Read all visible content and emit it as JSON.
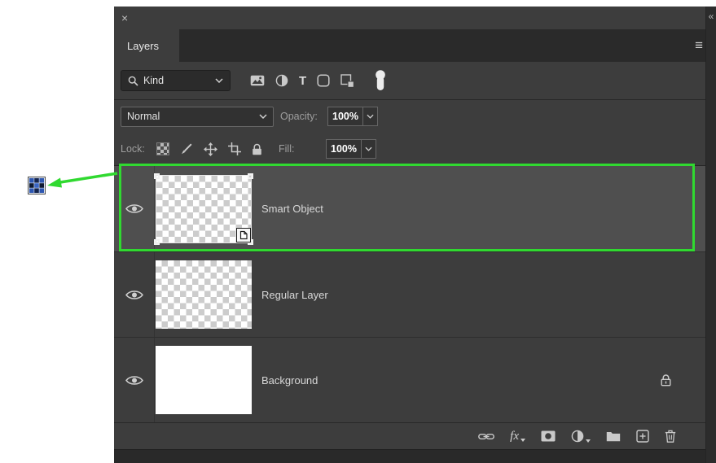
{
  "colors": {
    "highlight_green": "#30d930",
    "panel_bg": "#3d3d3d",
    "selected_row_bg": "#4f4f4f"
  },
  "annotation": {
    "callout_icon": "smart-object-mini-icon",
    "arrow": "green-arrow-pointing-left-from-selected-layer"
  },
  "panel": {
    "close_icon": "×",
    "collapse_icon": "«",
    "menu_icon": "≡",
    "title_tab": "Layers",
    "filter_row": {
      "kind_label": "Kind",
      "type_glyph": "T",
      "icons": [
        "search-icon",
        "pixel-layer-filter-icon",
        "adjustment-layer-filter-icon",
        "type-layer-filter-icon",
        "shape-layer-filter-icon",
        "smart-object-filter-icon",
        "filter-toggle-switch"
      ]
    },
    "blend_row": {
      "blend_mode": "Normal",
      "opacity_label": "Opacity:",
      "opacity_value": "100%"
    },
    "lock_row": {
      "lock_label": "Lock:",
      "fill_label": "Fill:",
      "fill_value": "100%",
      "icons": [
        "lock-transparency-icon",
        "lock-pixels-brush-icon",
        "lock-position-move-icon",
        "lock-artboard-icon",
        "lock-all-padlock-icon"
      ]
    },
    "layers": [
      {
        "name": "Smart Object",
        "selected": true,
        "visible": true,
        "thumbnail": "transparent-checkerboard",
        "badge": "smart-object-badge",
        "locked": false,
        "highlighted": true
      },
      {
        "name": "Regular Layer",
        "selected": false,
        "visible": true,
        "thumbnail": "transparent-checkerboard",
        "badge": null,
        "locked": false,
        "highlighted": false
      },
      {
        "name": "Background",
        "selected": false,
        "visible": true,
        "thumbnail": "white",
        "badge": null,
        "locked": true,
        "highlighted": false
      }
    ],
    "bottom_bar": {
      "fx_label": "fx",
      "icons": [
        "link-layers-icon",
        "layer-style-fx-icon",
        "add-layer-mask-icon",
        "new-adjustment-layer-icon",
        "new-group-folder-icon",
        "new-layer-icon",
        "delete-layer-trash-icon"
      ]
    }
  }
}
